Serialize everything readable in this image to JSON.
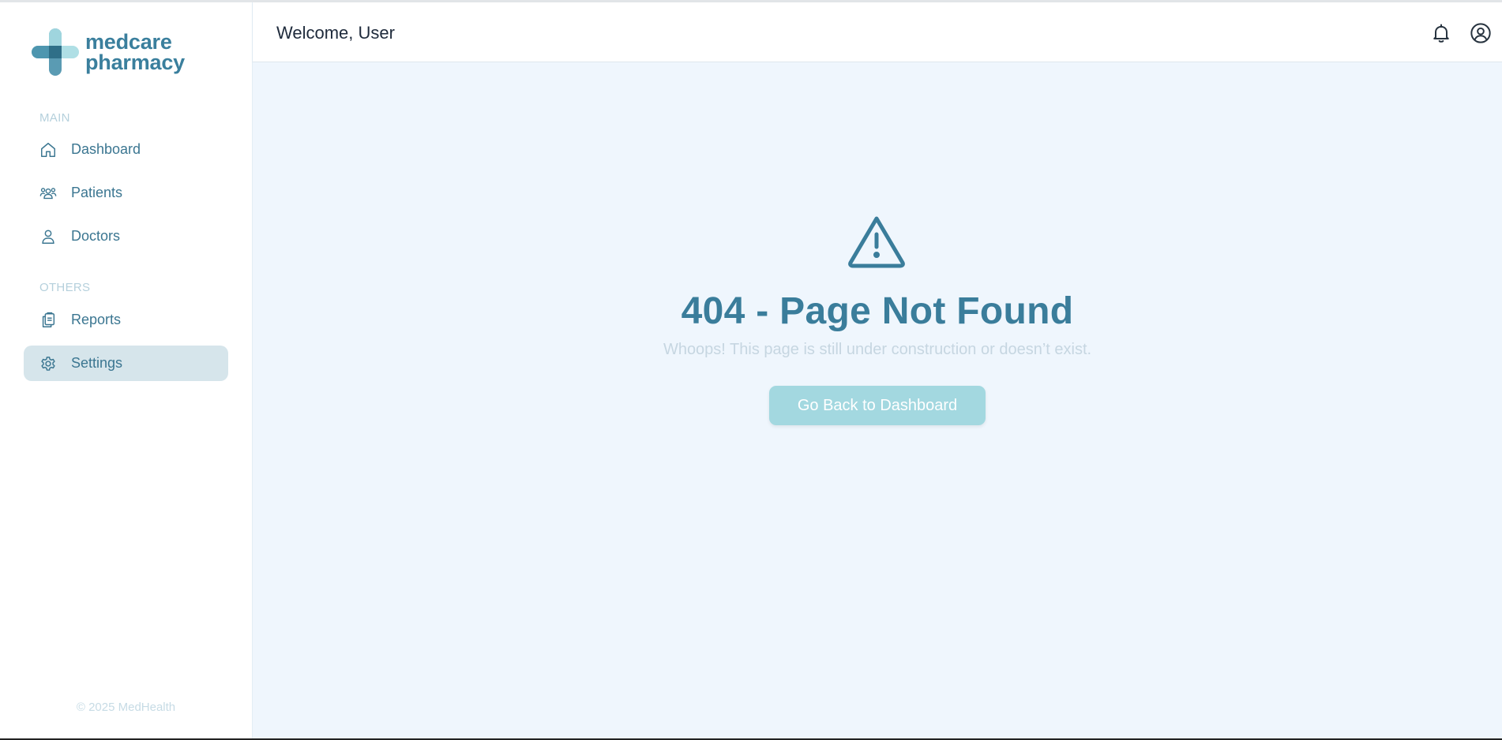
{
  "app": {
    "logo_line1": "medcare",
    "logo_line2": "pharmacy",
    "copyright": "© 2025 MedHealth"
  },
  "sidebar": {
    "sections": [
      {
        "label": "MAIN",
        "items": [
          {
            "label": "Dashboard",
            "icon": "home-icon"
          },
          {
            "label": "Patients",
            "icon": "users-icon"
          },
          {
            "label": "Doctors",
            "icon": "user-icon"
          }
        ]
      },
      {
        "label": "OTHERS",
        "items": [
          {
            "label": "Reports",
            "icon": "clipboard-icon"
          },
          {
            "label": "Settings",
            "icon": "gear-icon",
            "active": true
          }
        ]
      }
    ]
  },
  "header": {
    "welcome": "Welcome, User",
    "icons": [
      "bell-icon",
      "user-circle-icon"
    ]
  },
  "main": {
    "icon": "warning-triangle-icon",
    "title": "404 - Page Not Found",
    "subtitle": "Whoops! This page is still under construction or doesn’t exist.",
    "button_label": "Go Back to Dashboard"
  },
  "colors": {
    "brand": "#3a7d9b",
    "main_bg": "#eff6fd",
    "active_nav_bg": "#d6e5eb",
    "button_bg": "#a3d8e0"
  }
}
